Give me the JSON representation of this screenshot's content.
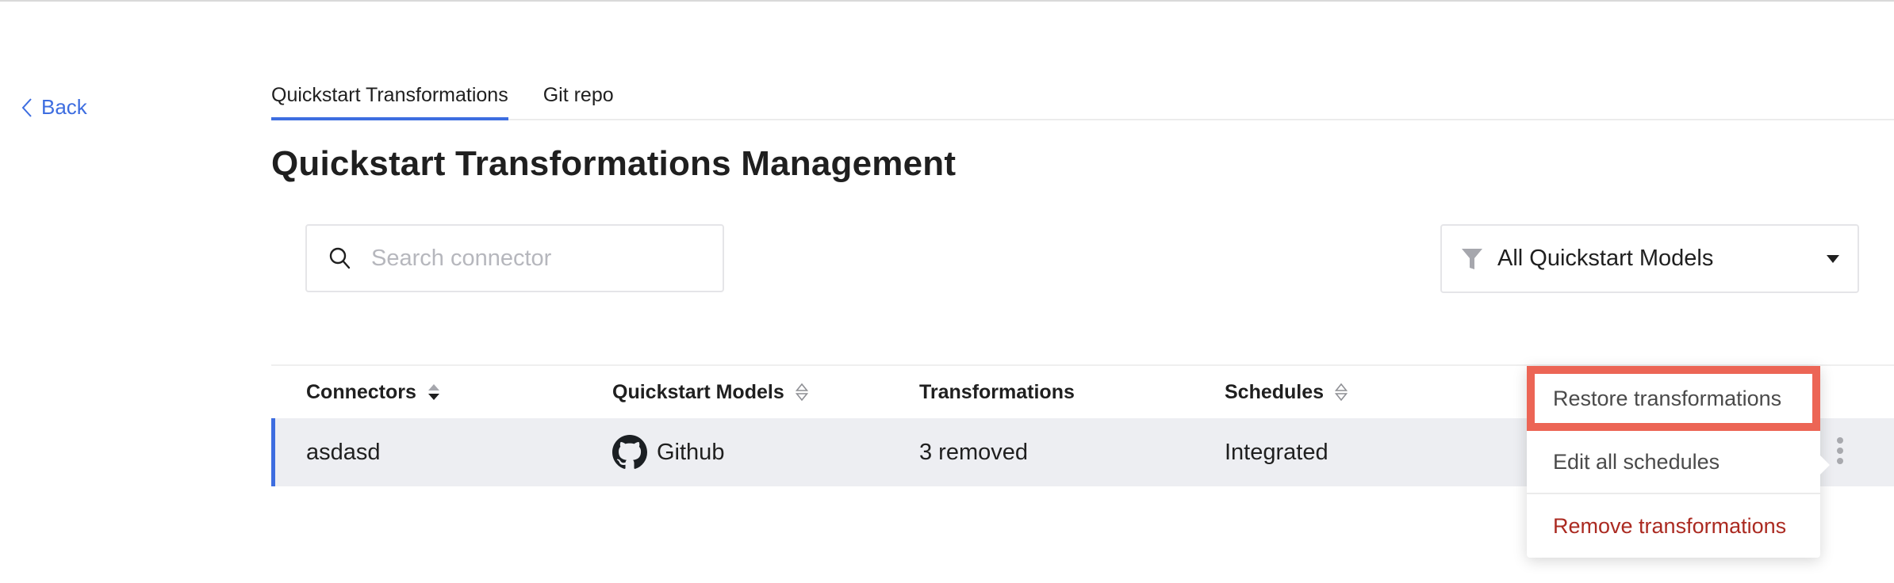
{
  "nav": {
    "back_label": "Back"
  },
  "tabs": [
    {
      "label": "Quickstart Transformations",
      "active": true
    },
    {
      "label": "Git repo",
      "active": false
    }
  ],
  "page": {
    "title": "Quickstart Transformations Management"
  },
  "search": {
    "placeholder": "Search connector",
    "value": ""
  },
  "filter": {
    "selected": "All Quickstart Models",
    "icon": "filter-funnel-icon"
  },
  "table": {
    "columns": [
      {
        "label": "Connectors",
        "sortable": true,
        "sort": "descending"
      },
      {
        "label": "Quickstart Models",
        "sortable": true,
        "sort": "none"
      },
      {
        "label": "Transformations",
        "sortable": false
      },
      {
        "label": "Schedules",
        "sortable": true,
        "sort": "none"
      }
    ],
    "rows": [
      {
        "connector": "asdasd",
        "model": "Github",
        "model_icon": "github-icon",
        "transformations": "3 removed",
        "schedules": "Integrated"
      }
    ]
  },
  "context_menu": {
    "items": [
      {
        "label": "Restore transformations",
        "highlighted": true
      },
      {
        "label": "Edit all schedules"
      },
      {
        "label": "Remove transformations",
        "danger": true
      }
    ]
  },
  "colors": {
    "accent": "#3d6de0",
    "highlight": "#ec6555",
    "danger": "#ab2a21",
    "row_bg": "#edeef2"
  }
}
